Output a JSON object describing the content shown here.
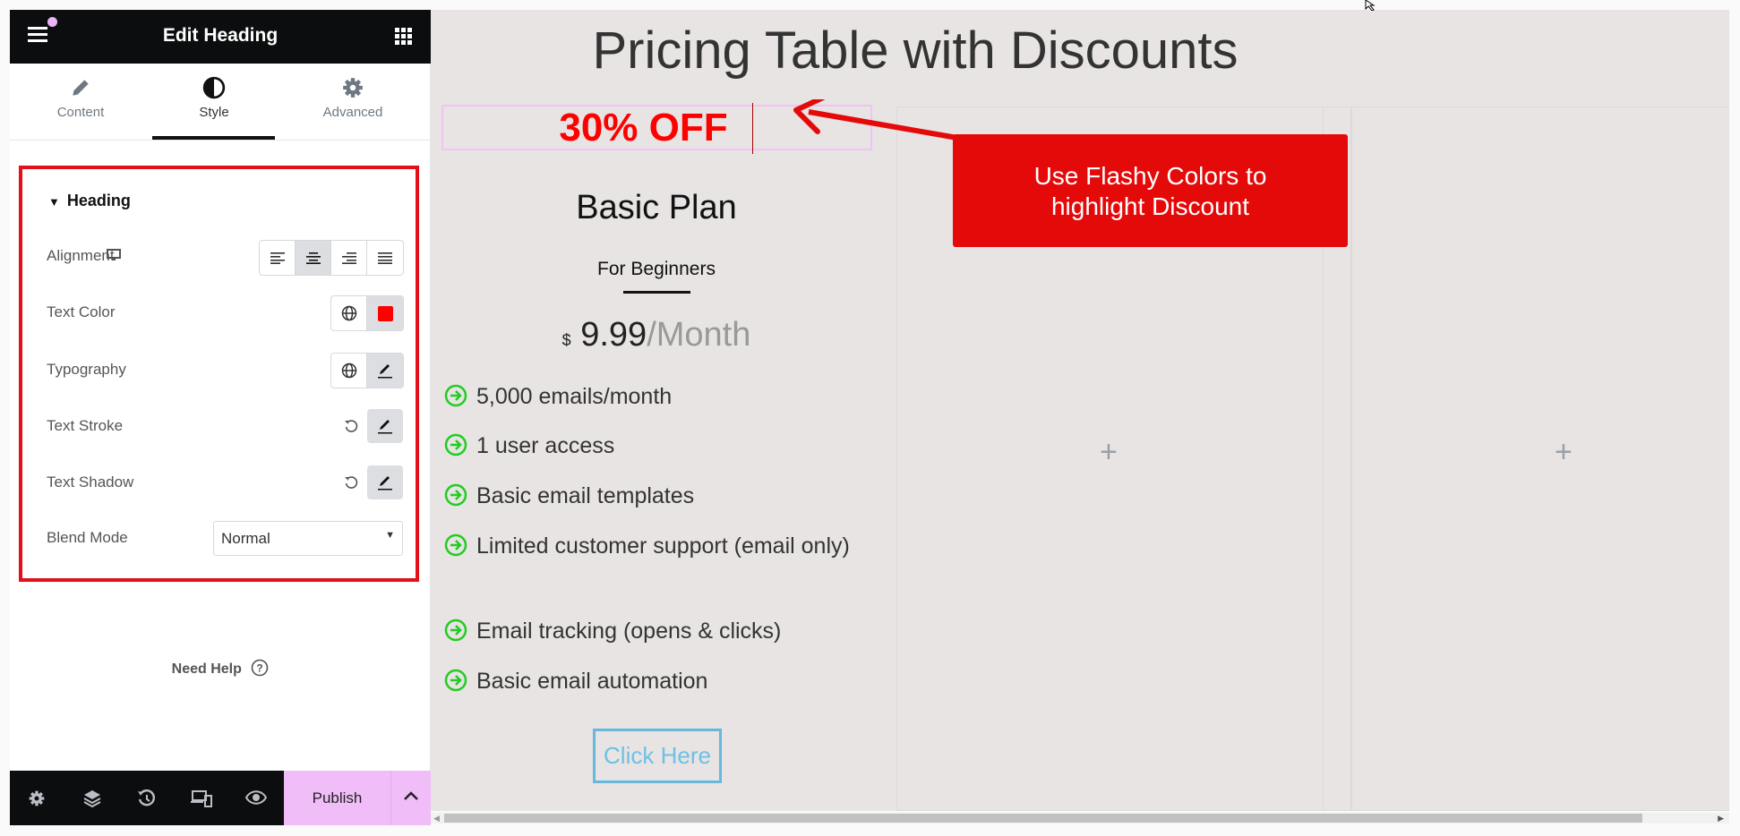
{
  "panel": {
    "title": "Edit Heading",
    "tabs": [
      {
        "label": "Content",
        "icon": "pencil-icon"
      },
      {
        "label": "Style",
        "icon": "contrast-icon",
        "active": true
      },
      {
        "label": "Advanced",
        "icon": "gear-icon"
      }
    ],
    "section": "Heading",
    "controls": {
      "alignment": "Alignment",
      "alignment_options": [
        "left",
        "center",
        "right",
        "justify"
      ],
      "alignment_selected": "center",
      "text_color": "Text Color",
      "text_color_value": "#ff0000",
      "typography": "Typography",
      "text_stroke": "Text Stroke",
      "text_shadow": "Text Shadow",
      "blend_mode": "Blend Mode",
      "blend_mode_value": "Normal"
    },
    "need_help": "Need Help",
    "footer": {
      "publish": "Publish",
      "icons": [
        "settings-icon",
        "layers-icon",
        "history-icon",
        "responsive-icon",
        "preview-icon"
      ]
    }
  },
  "canvas": {
    "title": "Pricing Table with Discounts",
    "discount": "30% OFF",
    "callout": [
      "Use Flashy Colors to",
      "highlight Discount"
    ],
    "plan": {
      "name": "Basic Plan",
      "subtitle": "For Beginners",
      "currency": "$",
      "price": "9.99",
      "period": "/Month",
      "features": [
        "5,000 emails/month",
        "1 user access",
        "Basic email templates",
        "Limited customer support (email only)",
        "Email tracking (opens & clicks)",
        "Basic email automation"
      ],
      "button": "Click Here"
    }
  },
  "colors": {
    "accent_red": "#e40a0a",
    "discount": "#ff0000",
    "publish": "#f0bdf8",
    "check": "#22cc22",
    "button": "#68b7dc"
  }
}
